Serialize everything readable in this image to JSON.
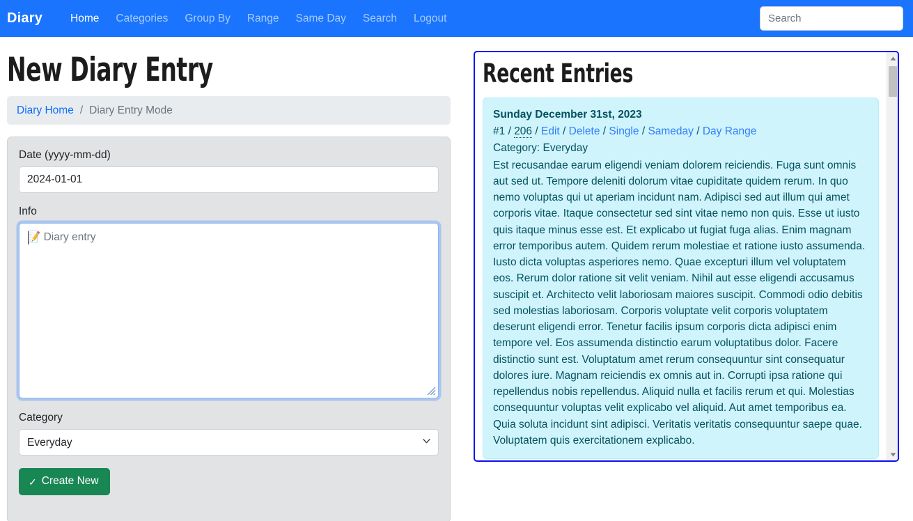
{
  "navbar": {
    "brand": "Diary",
    "links": [
      {
        "label": "Home",
        "active": true
      },
      {
        "label": "Categories",
        "active": false
      },
      {
        "label": "Group By",
        "active": false
      },
      {
        "label": "Range",
        "active": false
      },
      {
        "label": "Same Day",
        "active": false
      },
      {
        "label": "Search",
        "active": false
      },
      {
        "label": "Logout",
        "active": false
      }
    ],
    "search_placeholder": "Search",
    "search_value": "",
    "bg_color": "#1a74fd"
  },
  "main": {
    "page_title": "New Diary Entry",
    "breadcrumb": {
      "home_label": "Diary Home",
      "separator": "/",
      "current_label": "Diary Entry Mode"
    },
    "form": {
      "date_label": "Date (yyyy-mm-dd)",
      "date_value": "2024-01-01",
      "date_placeholder": "",
      "info_label": "Info",
      "info_value": "",
      "info_placeholder": "📝 Diary entry",
      "category_label": "Category",
      "category_value": "Everyday",
      "category_options": [
        "Everyday"
      ],
      "submit_label": "Create New",
      "submit_icon": "check-icon",
      "submit_color": "#198754"
    }
  },
  "sidebar": {
    "title": "Recent Entries",
    "border_color": "#0d0df5",
    "entries": [
      {
        "date": "Sunday December 31st, 2023",
        "index_label": "#1",
        "number": "206",
        "links": [
          "Edit",
          "Delete",
          "Single",
          "Sameday",
          "Day Range"
        ],
        "separator": "/",
        "category_label": "Category:",
        "category_value": "Everyday",
        "body": "Est recusandae earum eligendi veniam dolorem reiciendis. Fuga sunt omnis aut sed ut. Tempore deleniti dolorum vitae cupiditate quidem rerum. In quo nemo voluptas qui ut aperiam incidunt nam. Adipisci sed aut illum qui amet corporis vitae. Itaque consectetur sed sint vitae nemo non quis. Esse ut iusto quis itaque minus esse est. Et explicabo ut fugiat fuga alias. Enim magnam error temporibus autem. Quidem rerum molestiae et ratione iusto assumenda. Iusto dicta voluptas asperiores nemo. Quae excepturi illum vel voluptatem eos. Rerum dolor ratione sit velit veniam. Nihil aut esse eligendi accusamus suscipit et. Architecto velit laboriosam maiores suscipit. Commodi odio debitis sed molestias laboriosam. Corporis voluptate velit corporis voluptatem deserunt eligendi error. Tenetur facilis ipsum corporis dicta adipisci enim tempore vel. Eos assumenda distinctio earum voluptatibus dolor. Facere distinctio sunt est. Voluptatum amet rerum consequuntur sint consequatur dolores iure. Magnam reiciendis ex omnis aut in. Corrupti ipsa ratione qui repellendus nobis repellendus. Aliquid nulla et facilis rerum et qui. Molestias consequuntur voluptas velit explicabo vel aliquid. Aut amet temporibus ea. Quia soluta incidunt sint adipisci. Veritatis veritatis consequuntur saepe quae. Voluptatem quis exercitationem explicabo."
      }
    ]
  }
}
